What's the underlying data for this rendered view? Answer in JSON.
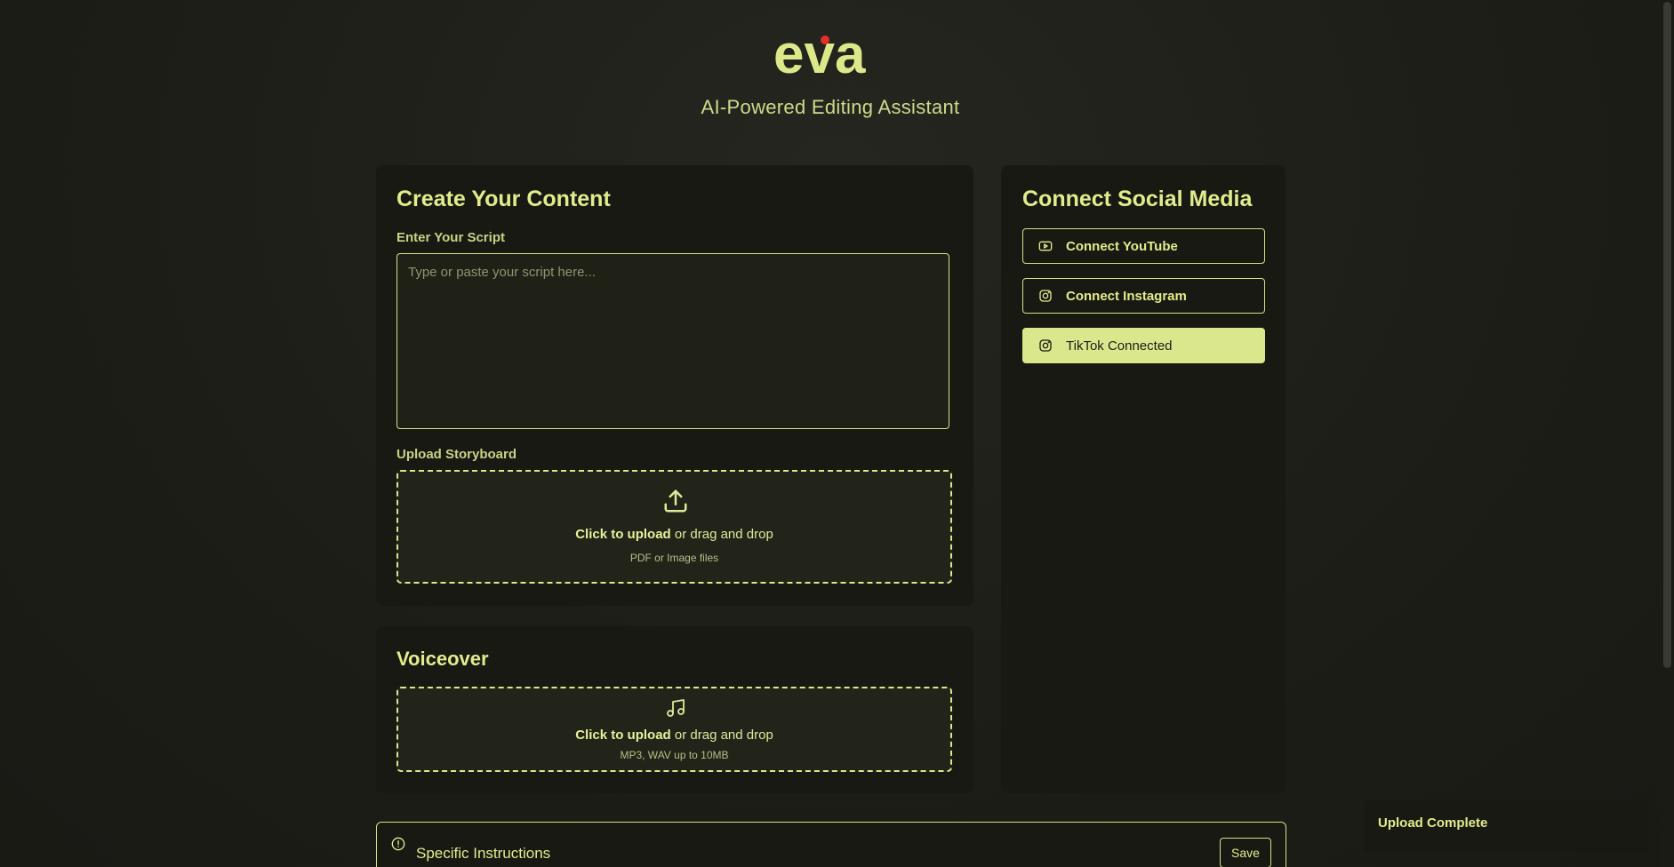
{
  "header": {
    "logo_text": "eva",
    "tagline": "AI-Powered Editing Assistant"
  },
  "create": {
    "title": "Create Your Content",
    "script_label": "Enter Your Script",
    "script_placeholder": "Type or paste your script here...",
    "storyboard_label": "Upload Storyboard",
    "storyboard_upload_strong": "Click to upload",
    "storyboard_upload_rest": " or drag and drop",
    "storyboard_hint": "PDF or Image files"
  },
  "voiceover": {
    "title": "Voiceover",
    "upload_strong": "Click to upload",
    "upload_rest": " or drag and drop",
    "hint": "MP3, WAV up to 10MB"
  },
  "social": {
    "title": "Connect Social Media",
    "buttons": [
      {
        "label": "Connect YouTube",
        "icon": "youtube-icon",
        "connected": false
      },
      {
        "label": "Connect Instagram",
        "icon": "instagram-icon",
        "connected": false
      },
      {
        "label": "TikTok Connected",
        "icon": "tiktok-icon",
        "connected": true
      }
    ]
  },
  "instructions": {
    "title": "Specific Instructions",
    "save_label": "Save",
    "icon": "info-icon"
  },
  "toast": {
    "message": "Upload Complete"
  },
  "colors": {
    "accent": "#dbe78d",
    "background": "#1f1f19",
    "card": "#191914"
  }
}
